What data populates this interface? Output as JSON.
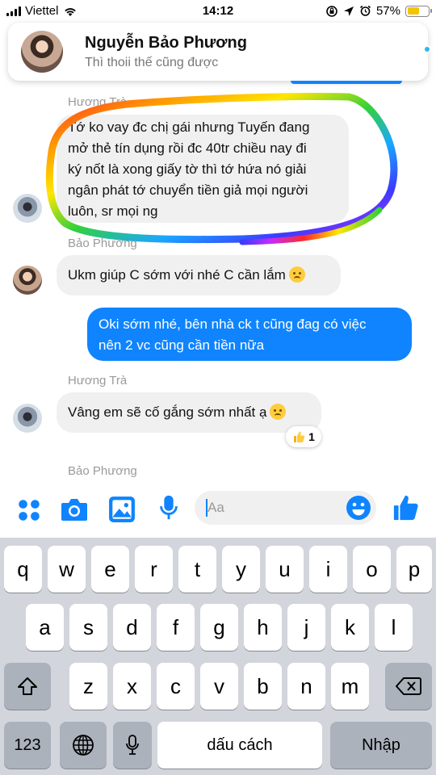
{
  "status_bar": {
    "carrier": "Viettel",
    "time": "14:12",
    "battery_percent": "57%",
    "battery_level": 0.57,
    "icons": [
      "signal-icon",
      "wifi-icon",
      "screen-lock-icon",
      "location-icon",
      "alarm-icon",
      "battery-icon"
    ]
  },
  "chat_header": {
    "name": "Nguyễn Bảo Phương",
    "subtitle": "Thì thoii thế cũng được"
  },
  "messages": [
    {
      "sender": "Hương Trà",
      "direction": "in",
      "lines": [
        "Tớ ko vay đc chị gái nhưng Tuyến đang",
        "mở thẻ tín dụng rồi đc 40tr chiều nay đi",
        "ký nốt là xong giấy tờ thì tớ hứa nó giải",
        "ngân phát tớ chuyển tiền giả mọi người",
        "luôn, sr mọi ng"
      ]
    },
    {
      "sender": "Bảo Phương",
      "direction": "in",
      "text": "Ukm giúp C sớm với nhé C cần lắm"
    },
    {
      "direction": "out",
      "lines": [
        "Oki sớm nhé, bên nhà ck t cũng đag có việc",
        "nên 2 vc cũng cần tiền nữa"
      ]
    },
    {
      "sender": "Hương Trà",
      "direction": "in",
      "text": "Vâng em sẽ cố gắng sớm nhất ạ",
      "reaction": {
        "icon": "thumbs-up-icon",
        "count": "1"
      }
    },
    {
      "sender": "Bảo Phương"
    }
  ],
  "composer": {
    "placeholder": "Aa",
    "icons": [
      "apps-icon",
      "camera-icon",
      "gallery-icon",
      "microphone-icon",
      "emoji-icon",
      "like-icon"
    ]
  },
  "keyboard": {
    "row1": [
      "q",
      "w",
      "e",
      "r",
      "t",
      "y",
      "u",
      "i",
      "o",
      "p"
    ],
    "row2": [
      "a",
      "s",
      "d",
      "f",
      "g",
      "h",
      "j",
      "k",
      "l"
    ],
    "row3": [
      "z",
      "x",
      "c",
      "v",
      "b",
      "n",
      "m"
    ],
    "numbers_label": "123",
    "space_label": "dấu cách",
    "return_label": "Nhập"
  },
  "colors": {
    "accent": "#0f84fe",
    "incoming_bubble": "#f1f0f0",
    "keyboard_bg": "#d2d5db"
  }
}
